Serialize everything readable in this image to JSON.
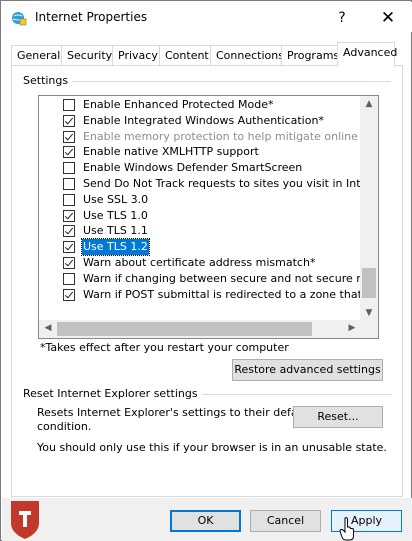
{
  "window": {
    "title": "Internet Properties",
    "help_label": "?",
    "close_label": "✕"
  },
  "tabs": [
    {
      "label": "General"
    },
    {
      "label": "Security"
    },
    {
      "label": "Privacy"
    },
    {
      "label": "Content"
    },
    {
      "label": "Connections"
    },
    {
      "label": "Programs"
    },
    {
      "label": "Advanced",
      "active": true
    }
  ],
  "settings": {
    "group_label": "Settings",
    "items": [
      {
        "label": "Enable Enhanced Protected Mode*",
        "checked": false,
        "disabled": false,
        "selected": false
      },
      {
        "label": "Enable Integrated Windows Authentication*",
        "checked": true,
        "disabled": false,
        "selected": false
      },
      {
        "label": "Enable memory protection to help mitigate online attacks*",
        "checked": true,
        "disabled": true,
        "selected": false
      },
      {
        "label": "Enable native XMLHTTP support",
        "checked": true,
        "disabled": false,
        "selected": false
      },
      {
        "label": "Enable Windows Defender SmartScreen",
        "checked": false,
        "disabled": false,
        "selected": false
      },
      {
        "label": "Send Do Not Track requests to sites you visit in Internet E",
        "checked": false,
        "disabled": false,
        "selected": false
      },
      {
        "label": "Use SSL 3.0",
        "checked": false,
        "disabled": false,
        "selected": false
      },
      {
        "label": "Use TLS 1.0",
        "checked": true,
        "disabled": false,
        "selected": false
      },
      {
        "label": "Use TLS 1.1",
        "checked": true,
        "disabled": false,
        "selected": false
      },
      {
        "label": "Use TLS 1.2",
        "checked": true,
        "disabled": false,
        "selected": true
      },
      {
        "label": "Warn about certificate address mismatch*",
        "checked": true,
        "disabled": false,
        "selected": false
      },
      {
        "label": "Warn if changing between secure and not secure mode",
        "checked": false,
        "disabled": false,
        "selected": false
      },
      {
        "label": "Warn if POST submittal is redirected to a zone that does n",
        "checked": true,
        "disabled": false,
        "selected": false
      }
    ],
    "note": "*Takes effect after you restart your computer",
    "restore_button": "Restore advanced settings"
  },
  "reset": {
    "group_label": "Reset Internet Explorer settings",
    "description_line1": "Resets Internet Explorer's settings to their default",
    "description_line2": "condition.",
    "reset_button": "Reset...",
    "warning": "You should only use this if your browser is in an unusable state."
  },
  "footer": {
    "ok_label": "OK",
    "cancel_label": "Cancel",
    "apply_label": "Apply"
  },
  "colors": {
    "accent": "#0078d7",
    "logo": "#c0392b"
  }
}
